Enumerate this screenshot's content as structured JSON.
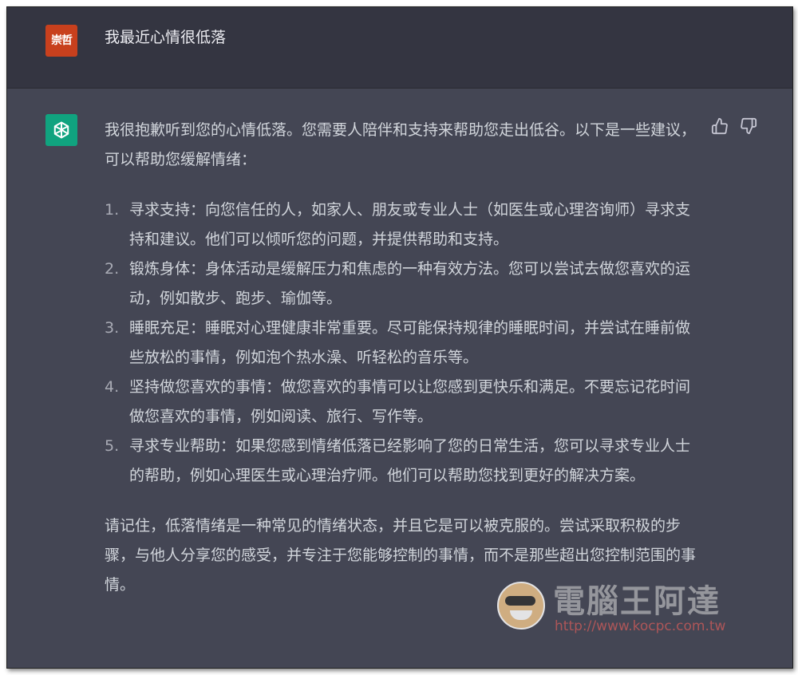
{
  "user": {
    "avatar_text": "崇哲",
    "avatar_color": "#c8401d",
    "message": "我最近心情很低落"
  },
  "assistant": {
    "avatar_icon": "openai-logo-icon",
    "avatar_color": "#10a37f",
    "intro": "我很抱歉听到您的心情低落。您需要人陪伴和支持来帮助您走出低谷。以下是一些建议，可以帮助您缓解情绪：",
    "tips": [
      {
        "number": "1.",
        "text": "寻求支持：向您信任的人，如家人、朋友或专业人士（如医生或心理咨询师）寻求支持和建议。他们可以倾听您的问题，并提供帮助和支持。"
      },
      {
        "number": "2.",
        "text": "锻炼身体：身体活动是缓解压力和焦虑的一种有效方法。您可以尝试去做您喜欢的运动，例如散步、跑步、瑜伽等。"
      },
      {
        "number": "3.",
        "text": "睡眠充足：睡眠对心理健康非常重要。尽可能保持规律的睡眠时间，并尝试在睡前做些放松的事情，例如泡个热水澡、听轻松的音乐等。"
      },
      {
        "number": "4.",
        "text": "坚持做您喜欢的事情：做您喜欢的事情可以让您感到更快乐和满足。不要忘记花时间做您喜欢的事情，例如阅读、旅行、写作等。"
      },
      {
        "number": "5.",
        "text": "寻求专业帮助：如果您感到情绪低落已经影响了您的日常生活，您可以寻求专业人士的帮助，例如心理医生或心理治疗师。他们可以帮助您找到更好的解决方案。"
      }
    ],
    "closing": "请记住，低落情绪是一种常见的情绪状态，并且它是可以被克服的。尝试采取积极的步骤，与他人分享您的感受，并专注于您能够控制的事情，而不是那些超出您控制范围的事情。"
  },
  "feedback": {
    "thumbs_up_icon": "thumbs-up-icon",
    "thumbs_down_icon": "thumbs-down-icon"
  },
  "watermark": {
    "title": "電腦王阿達",
    "url": "http://www.kocpc.com.tw"
  },
  "colors": {
    "user_bg": "#343541",
    "assistant_bg": "#444654",
    "text": "#d1d5db"
  }
}
